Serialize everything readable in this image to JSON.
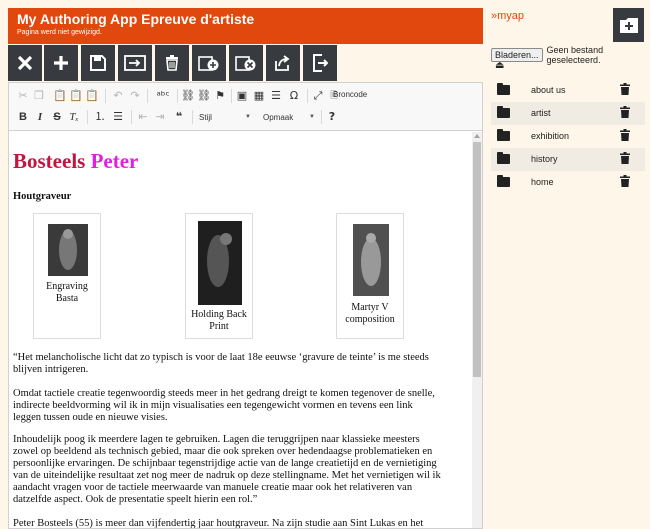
{
  "header": {
    "title": "My Authoring App Epreuve d'artiste",
    "subtitle": "Pagina werd niet gewijzigd."
  },
  "toolbar": {
    "buttons": [
      "close-icon",
      "add-icon",
      "save-icon",
      "move-icon",
      "trash-icon",
      "add-page-icon",
      "remove-page-icon",
      "export-icon",
      "logout-icon"
    ]
  },
  "rte": {
    "source_label": "Broncode",
    "style_combo": "Stijl",
    "format_combo": "Opmaak",
    "help": "?"
  },
  "content": {
    "heading_last": "Bosteels",
    "heading_first": "Peter",
    "subtitle": "Houtgraveur",
    "artworks": [
      {
        "caption": "Engraving Basta"
      },
      {
        "caption": "Holding Back Print"
      },
      {
        "caption": "Martyr V composition"
      }
    ],
    "paragraphs": [
      "“Het melancholische licht dat zo typisch is voor de laat 18e eeuwse ‘gravure de teinte’ is me steeds blijven intrigeren.",
      "Omdat tactiele creatie tegenwoordig steeds meer in het gedrang dreigt te komen tegenover de snelle, indirecte beeldvorming wil ik in mijn visualisaties een tegengewicht vormen en tevens een link leggen tussen oude en nieuwe visies.",
      "Inhoudelijk poog ik meerdere lagen te gebruiken. Lagen die teruggrijpen naar klassieke meesters zowel op beeldend als technisch gebied, maar die ook spreken over hedendaagse problematieken en persoonlijke ervaringen. De schijnbaar tegenstrijdige actie van de lange creatietijd en de vernietiging van de uiteindelijke resultaat zet nog meer de nadruk op deze stellingname. Met het vernietigen wil ik aandacht vragen voor de tactiele meerwaarde van manuele creatie maar ook het relativeren van datzelfde aspect. Ook de presentatie speelt hierin een rol.”",
      "Peter Bosteels (55) is meer dan vijfendertig jaar houtgraveur. Na zijn studie aan Sint Lukas en het"
    ]
  },
  "sidebar": {
    "title": "»myap",
    "browse_button": "Bladeren...",
    "file_status": "Geen bestand geselecteerd.",
    "items": [
      {
        "label": "about us"
      },
      {
        "label": "artist"
      },
      {
        "label": "exhibition"
      },
      {
        "label": "history"
      },
      {
        "label": "home"
      }
    ]
  },
  "colors": {
    "brand": "#e0480d",
    "toolbar": "#373b3f",
    "heading_last": "#c0163f",
    "heading_first": "#e020e0"
  }
}
